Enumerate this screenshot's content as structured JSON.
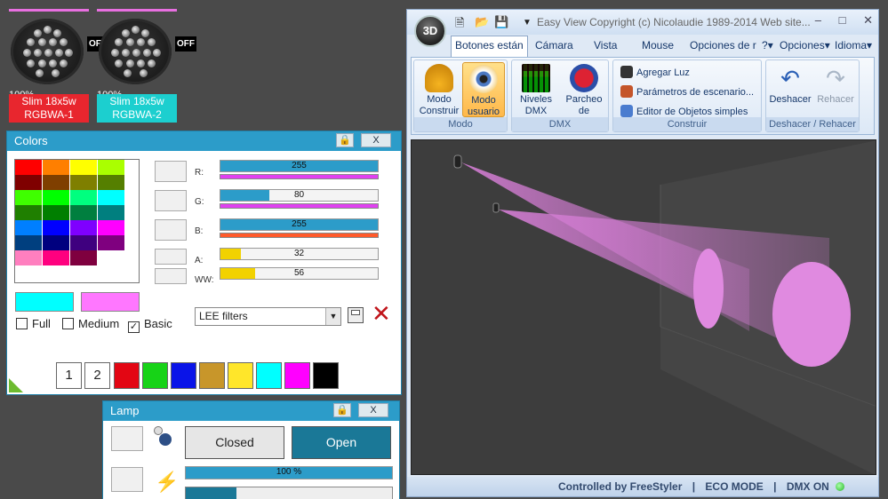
{
  "fixtures": [
    {
      "percent": "100%",
      "name_line1": "Slim 18x5w",
      "name_line2": "RGBWA-1",
      "state": "OFF",
      "label_color": "#e8262e"
    },
    {
      "percent": "100%",
      "name_line1": "Slim 18x5w",
      "name_line2": "RGBWA-2",
      "state": "OFF",
      "label_color": "#1ccfcf"
    }
  ],
  "colors_panel": {
    "title": "Colors",
    "lock_icon": "lock-icon",
    "close_label": "X",
    "palette": [
      "#ff0000",
      "#ff7f00",
      "#ffff00",
      "#aaff00",
      "#7f0000",
      "#7f3f00",
      "#7f7f00",
      "#557f00",
      "#3fff00",
      "#00ff00",
      "#00ff7f",
      "#00ffff",
      "#1f7f00",
      "#007f00",
      "#007f3f",
      "#007f7f",
      "#007fff",
      "#0000ff",
      "#7f00ff",
      "#ff00ff",
      "#003f7f",
      "#00007f",
      "#3f007f",
      "#7f007f",
      "#ff7fbf",
      "#ff007f",
      "#7f003f",
      "#ffffff"
    ],
    "channels": [
      {
        "label": "R:",
        "value": "255",
        "level": 1.0,
        "fill": "#2c9cc9",
        "under": "#e040f0"
      },
      {
        "label": "G:",
        "value": "80",
        "level": 0.31,
        "fill": "#2c9cc9",
        "under": "#e040f0"
      },
      {
        "label": "B:",
        "value": "255",
        "level": 1.0,
        "fill": "#2c9cc9",
        "under": "#ff5a2a"
      },
      {
        "label": "A:",
        "value": "32",
        "level": 0.13,
        "fill": "#f2d200",
        "under": ""
      },
      {
        "label": "WW:",
        "value": "56",
        "level": 0.22,
        "fill": "#f2d200",
        "under": ""
      }
    ],
    "current_colors": [
      "#00ffff",
      "#ff77ff"
    ],
    "checkboxes": [
      {
        "label": "Full",
        "checked": false
      },
      {
        "label": "Medium",
        "checked": false
      },
      {
        "label": "Basic",
        "checked": true
      }
    ],
    "filter_select": "LEE filters",
    "save_icon": "save-icon",
    "delete_icon": "delete-icon",
    "presets": [
      "1",
      "2"
    ],
    "preset_colors": [
      "#e30613",
      "#17d317",
      "#0a14e8",
      "#c8962a",
      "#ffe62a",
      "#00ffff",
      "#ff00ff",
      "#000000"
    ]
  },
  "lamp_panel": {
    "title": "Lamp",
    "close_label": "X",
    "closed_label": "Closed",
    "open_label": "Open",
    "dimmer_value": "100 %",
    "dimmer_level": 1.0
  },
  "app": {
    "orb_label": "3D",
    "title_text": "Easy View   Copyright (c) Nicolaudie 1989-2014   Web site...",
    "tabs": [
      "Botones están",
      "Cámara",
      "Vista",
      "Mouse",
      "Opciones de r"
    ],
    "right_tabs": [
      "?",
      "Opciones",
      "Idioma"
    ],
    "groups": {
      "modo": {
        "label": "Modo",
        "btn1": "Modo Construir",
        "btn2": "Modo usuario"
      },
      "dmx": {
        "label": "DMX",
        "btn1": "Niveles DMX",
        "btn2": "Parcheo de Universos"
      },
      "construir": {
        "label": "Construir",
        "item1": "Agregar Luz",
        "item2": "Parámetros de escenario...",
        "item3": "Editor de Objetos simples"
      },
      "deshacer": {
        "label": "Deshacer / Rehacer",
        "btn1": "Deshacer",
        "btn2": "Rehacer"
      }
    },
    "status": {
      "controlled": "Controlled by FreeStyler",
      "eco": "ECO MODE",
      "dmx": "DMX ON"
    }
  }
}
